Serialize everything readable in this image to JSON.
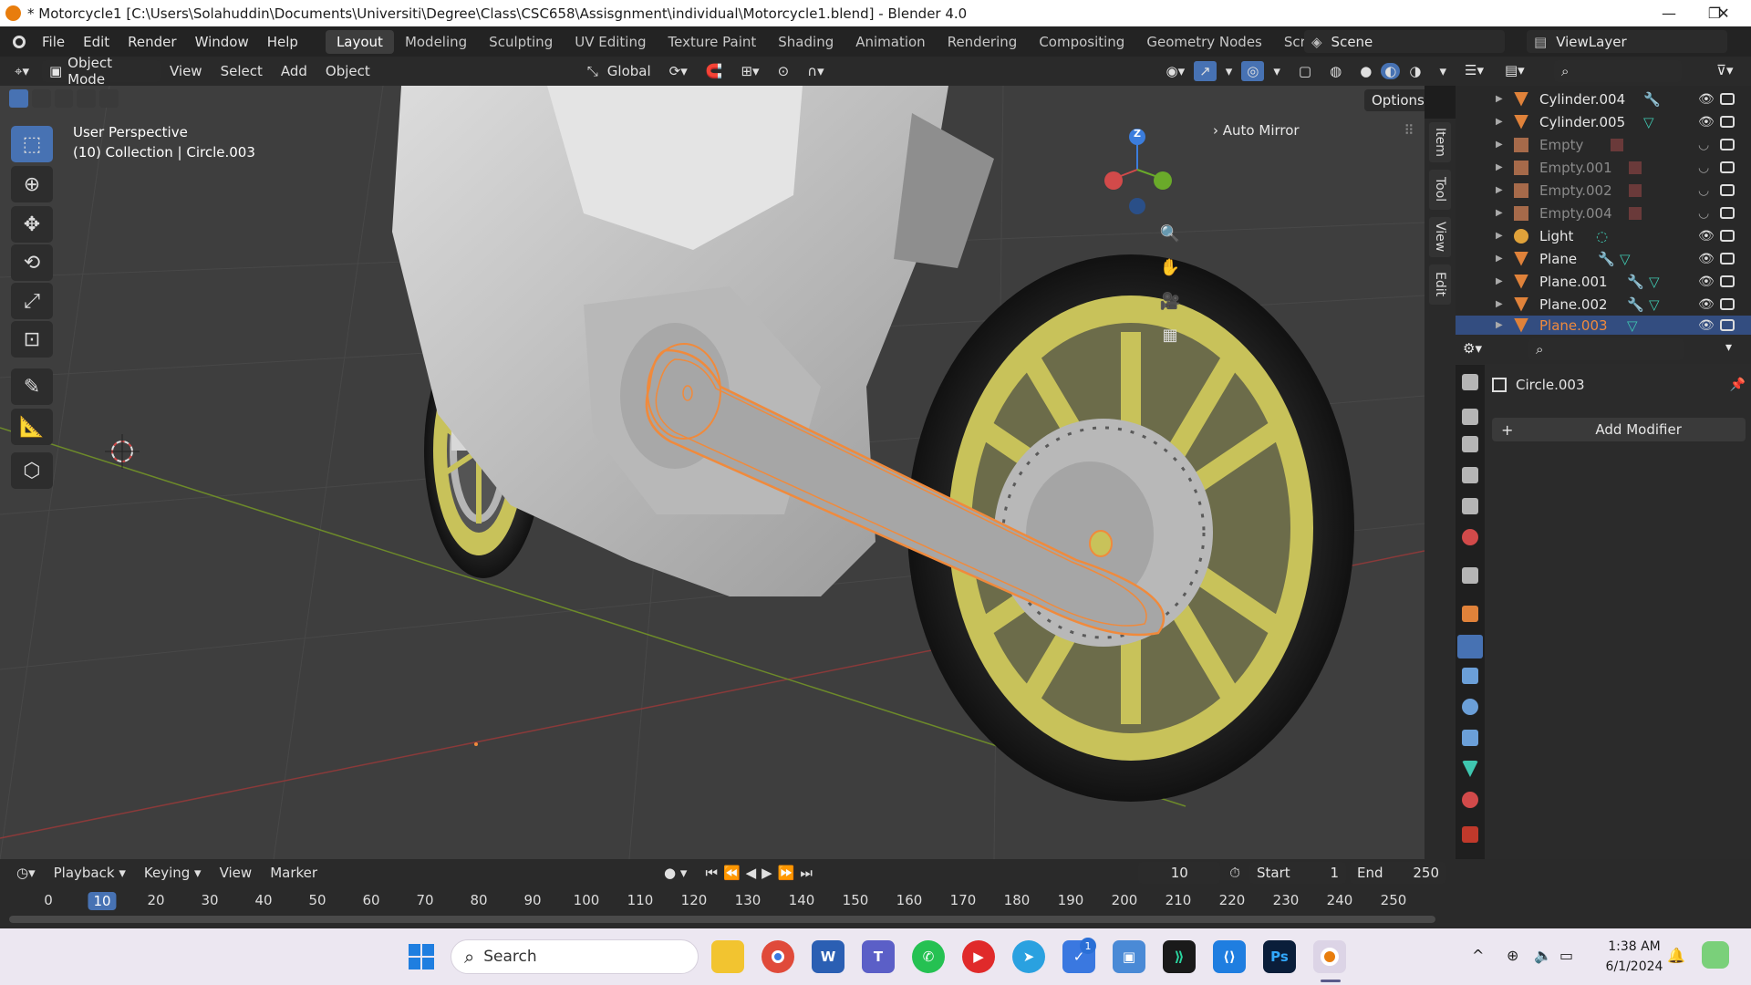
{
  "window": {
    "title": "* Motorcycle1 [C:\\Users\\Solahuddin\\Documents\\Universiti\\Degree\\Class\\CSC658\\Assisgnment\\individual\\Motorcycle1.blend] - Blender 4.0",
    "minimize": "—",
    "maximize": "❐",
    "close": "✕"
  },
  "menubar": {
    "items": [
      "File",
      "Edit",
      "Render",
      "Window",
      "Help"
    ],
    "workspaces": [
      "Layout",
      "Modeling",
      "Sculpting",
      "UV Editing",
      "Texture Paint",
      "Shading",
      "Animation",
      "Rendering",
      "Compositing",
      "Geometry Nodes",
      "Scripting"
    ],
    "active_workspace": "Layout",
    "add_workspace": "+",
    "scene": "Scene",
    "view_layer": "ViewLayer"
  },
  "header3d": {
    "mode": "Object Mode",
    "menus": [
      "View",
      "Select",
      "Add",
      "Object"
    ],
    "transform_orientation": "Global",
    "options": "Options"
  },
  "viewport": {
    "perspective_label": "User Perspective",
    "collection_label": "(10) Collection | Circle.003",
    "auto_mirror": "Auto Mirror",
    "gizmo_axis": "Z",
    "sidebar_tabs": [
      "Item",
      "Tool",
      "View",
      "Edit"
    ]
  },
  "outliner": {
    "search_placeholder": "",
    "items": [
      {
        "name": "Cylinder.004",
        "type": "mesh",
        "selected": false
      },
      {
        "name": "Cylinder.005",
        "type": "mesh",
        "selected": false
      },
      {
        "name": "Empty",
        "type": "empty",
        "selected": false
      },
      {
        "name": "Empty.001",
        "type": "empty",
        "selected": false
      },
      {
        "name": "Empty.002",
        "type": "empty",
        "selected": false
      },
      {
        "name": "Empty.004",
        "type": "empty",
        "selected": false
      },
      {
        "name": "Light",
        "type": "light",
        "selected": false
      },
      {
        "name": "Plane",
        "type": "mesh",
        "selected": false
      },
      {
        "name": "Plane.001",
        "type": "mesh",
        "selected": false
      },
      {
        "name": "Plane.002",
        "type": "mesh",
        "selected": false
      },
      {
        "name": "Plane.003",
        "type": "mesh",
        "selected": true
      }
    ]
  },
  "properties": {
    "object_name": "Circle.003",
    "add_modifier": "Add Modifier"
  },
  "timeline": {
    "menus": [
      "Playback",
      "Keying",
      "View",
      "Marker"
    ],
    "current_frame": "10",
    "start_label": "Start",
    "start_value": "1",
    "end_label": "End",
    "end_value": "250",
    "ticks": [
      "0",
      "10",
      "20",
      "30",
      "40",
      "50",
      "60",
      "70",
      "80",
      "90",
      "100",
      "110",
      "120",
      "130",
      "140",
      "150",
      "160",
      "170",
      "180",
      "190",
      "200",
      "210",
      "220",
      "230",
      "240",
      "250"
    ]
  },
  "taskbar": {
    "search_placeholder": "Search",
    "time": "1:38 AM",
    "date": "6/1/2024",
    "notification_badge": "1",
    "apps": [
      "windows-start",
      "file-explorer",
      "chrome",
      "word",
      "teams",
      "whatsapp",
      "media-player",
      "telegram",
      "todo",
      "control-panel",
      "pycharm",
      "vscode",
      "photoshop",
      "blender"
    ]
  },
  "colors": {
    "accent": "#4772b3",
    "selected_orange": "#f08a3c",
    "wheel_yellow": "#c8c25a",
    "body_gray": "#c9c9c9",
    "viewport_bg": "#3e3e3e",
    "taskbar_bg": "#ece7f1"
  }
}
